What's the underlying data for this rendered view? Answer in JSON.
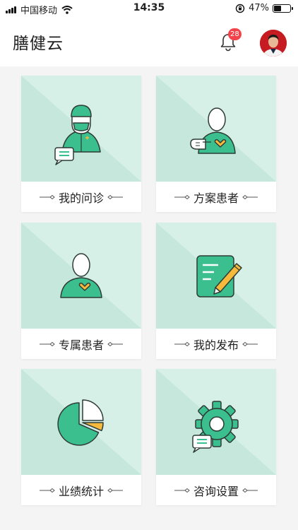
{
  "status_bar": {
    "carrier": "中国移动",
    "time": "14:35",
    "battery": "47%",
    "battery_level": 0.47
  },
  "header": {
    "title": "膳健云",
    "notification_count": "28"
  },
  "menu": [
    {
      "label": "我的问诊",
      "icon": "doctor-icon"
    },
    {
      "label": "方案患者",
      "icon": "patient-pointing-icon"
    },
    {
      "label": "专属患者",
      "icon": "patient-heart-icon"
    },
    {
      "label": "我的发布",
      "icon": "notepad-pencil-icon"
    },
    {
      "label": "业绩统计",
      "icon": "pie-chart-icon"
    },
    {
      "label": "咨询设置",
      "icon": "gear-chat-icon"
    }
  ],
  "colors": {
    "accent_green": "#3bbf8f",
    "card_bg": "#d6f0e8",
    "outline": "#2e3b36",
    "heart_yellow": "#f6b93b",
    "badge_red": "#f2434b"
  }
}
